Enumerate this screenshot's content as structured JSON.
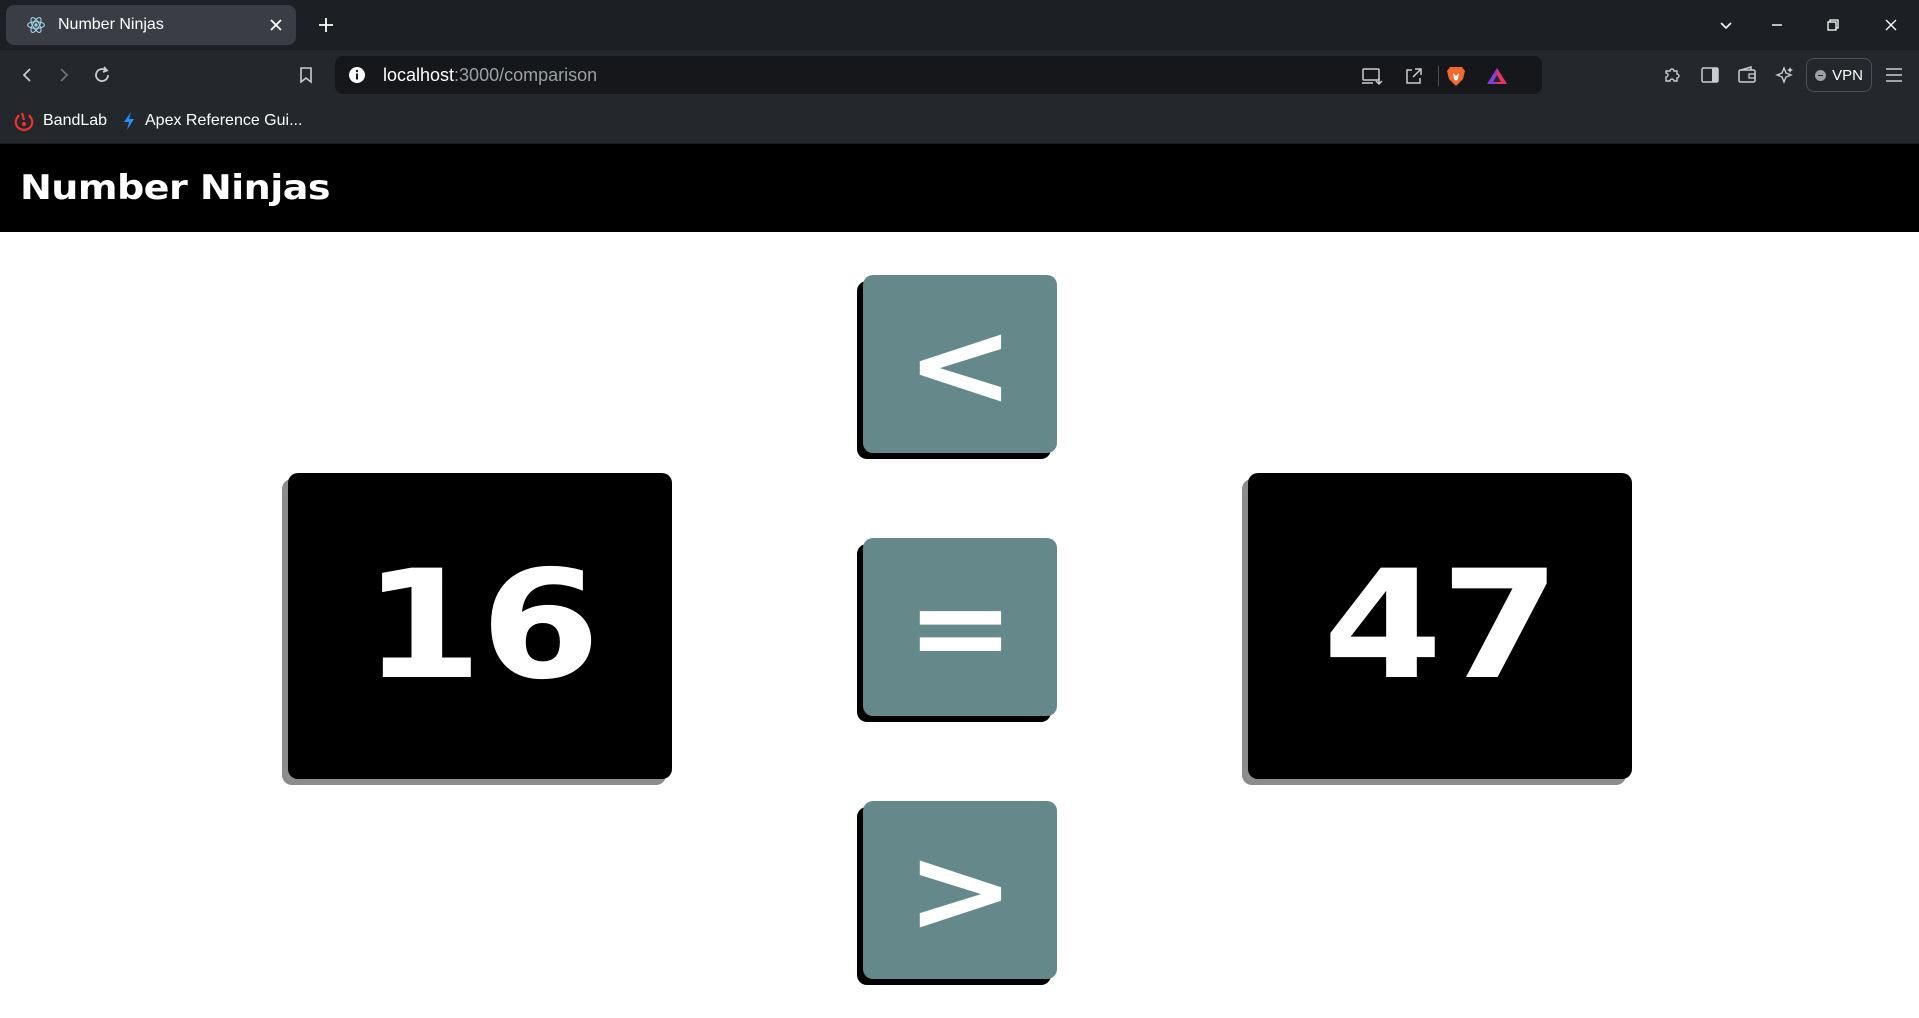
{
  "browser": {
    "tab_title": "Number Ninjas",
    "url_host": "localhost",
    "url_path": ":3000/comparison",
    "vpn_label": "VPN",
    "bookmarks": [
      {
        "label": "BandLab",
        "icon": "bandlab-icon"
      },
      {
        "label": "Apex Reference Gui...",
        "icon": "lightning-icon"
      }
    ]
  },
  "app": {
    "title": "Number Ninjas",
    "left_number": "16",
    "right_number": "47",
    "buttons": {
      "less_than": "<",
      "equal": "=",
      "greater_than": ">"
    },
    "colors": {
      "header_bg": "#000000",
      "card_bg": "#000000",
      "card_shadow": "#8c8c8c",
      "button_bg": "#65898a"
    }
  }
}
